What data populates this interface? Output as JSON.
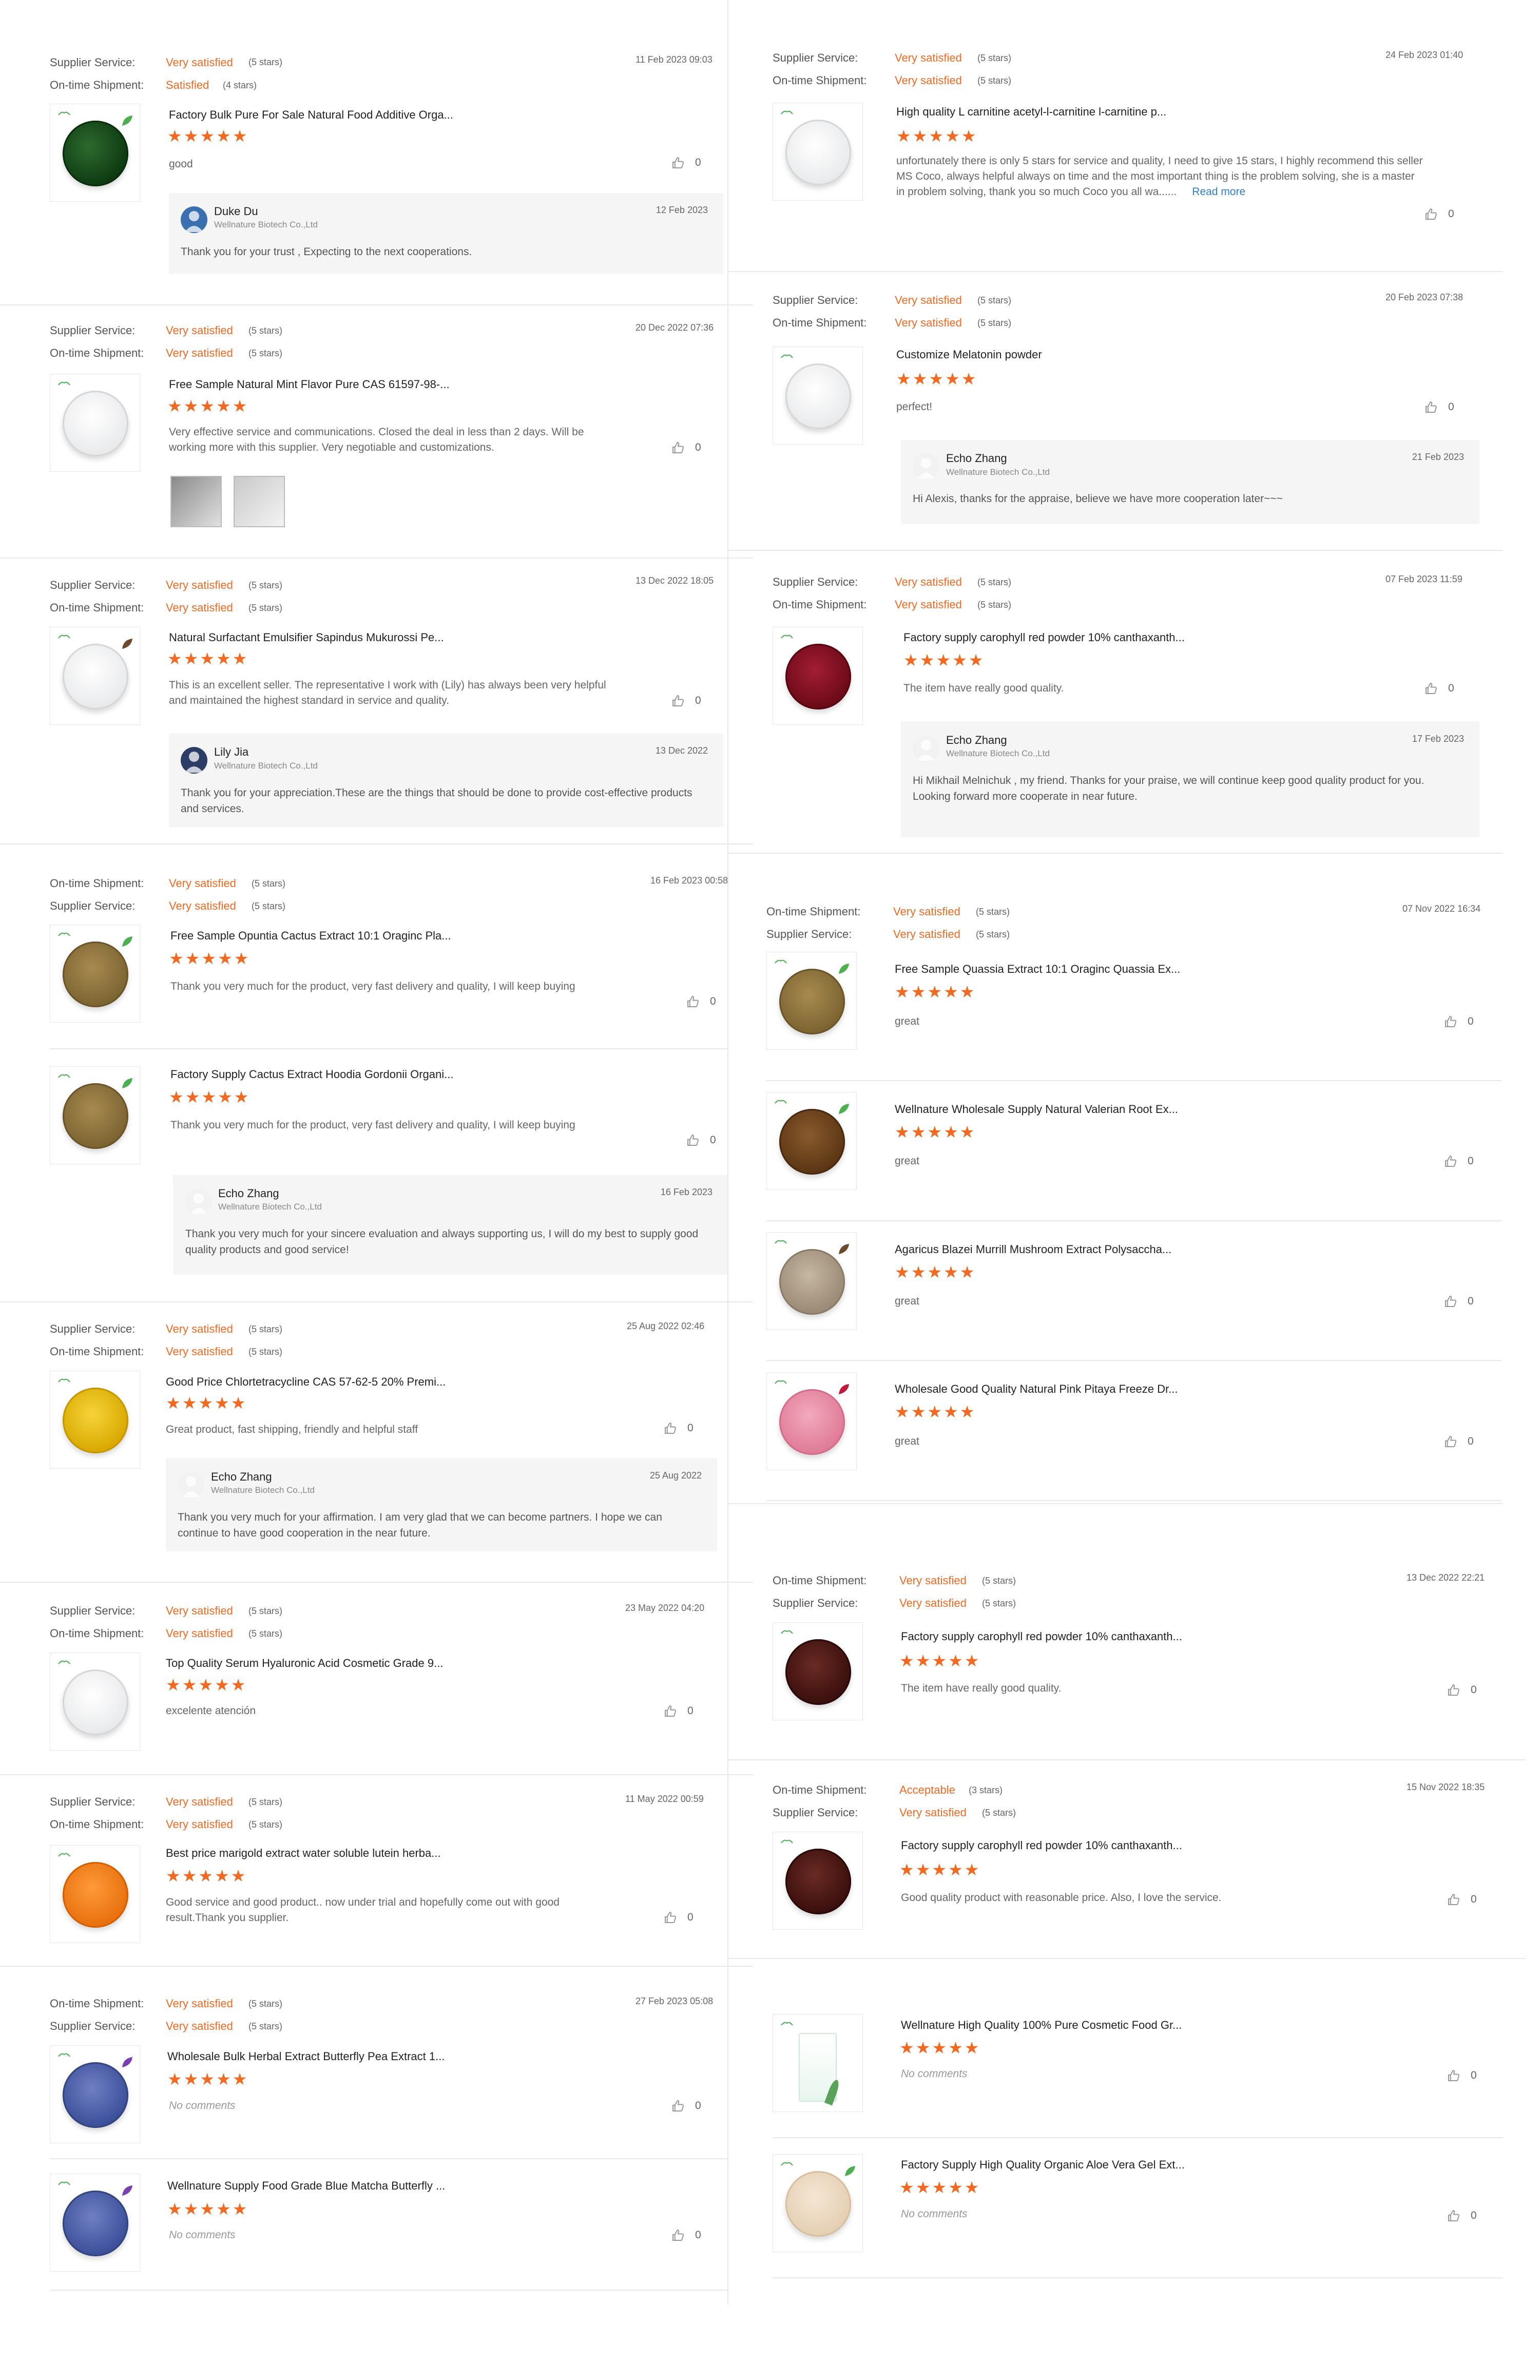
{
  "labels": {
    "supplier_service": "Supplier Service:",
    "ontime_shipment": "On-time Shipment:"
  },
  "accent_color": "#f26a21",
  "stars_glyph": "★★★★★",
  "left": [
    {
      "rows": [
        [
          "Supplier Service:",
          "Very satisfied",
          "(5 stars)"
        ],
        [
          "On-time Shipment:",
          "Satisfied",
          "(4 stars)"
        ]
      ],
      "date": "11 Feb 2023 09:03",
      "product": "Factory Bulk Pure For Sale Natural Food Additive Orga...",
      "rating": 5,
      "comment": "good",
      "likes": "0",
      "reply": {
        "name": "Duke Du",
        "company": "Wellnature Biotech Co.,Ltd",
        "date": "12 Feb 2023",
        "text": "Thank you for your trust , Expecting to the next cooperations."
      }
    },
    {
      "rows": [
        [
          "Supplier Service:",
          "Very satisfied",
          "(5 stars)"
        ],
        [
          "On-time Shipment:",
          "Very satisfied",
          "(5 stars)"
        ]
      ],
      "date": "20 Dec 2022 07:36",
      "product": "Free Sample Natural Mint Flavor Pure CAS 61597-98-...",
      "rating": 5,
      "comment": "Very effective service and communications. Closed the deal in less than 2 days. Will be working more with this supplier. Very negotiable and customizations.",
      "likes": "0"
    },
    {
      "rows": [
        [
          "Supplier Service:",
          "Very satisfied",
          "(5 stars)"
        ],
        [
          "On-time Shipment:",
          "Very satisfied",
          "(5 stars)"
        ]
      ],
      "date": "13 Dec 2022 18:05",
      "product": "Natural Surfactant Emulsifier Sapindus Mukurossi Pe...",
      "rating": 5,
      "comment": "This is an excellent seller. The representative I work with (Lily) has always been very helpful and maintained the highest standard in service and quality.",
      "likes": "0",
      "reply": {
        "name": "Lily Jia",
        "company": "Wellnature Biotech Co.,Ltd",
        "date": "13 Dec 2022",
        "text": "Thank you for your appreciation.These are the things that should be done to provide cost-effective products and services."
      }
    },
    {
      "rows": [
        [
          "On-time Shipment:",
          "Very satisfied",
          "(5 stars)"
        ],
        [
          "Supplier Service:",
          "Very satisfied",
          "(5 stars)"
        ]
      ],
      "date": "16 Feb 2023 00:58",
      "product": "Free Sample Opuntia Cactus Extract 10:1 Oraginc Pla...",
      "rating": 5,
      "comment": "Thank you very much for the product, very fast delivery and quality, I will keep buying",
      "likes": "0",
      "product2": "Factory Supply Cactus Extract Hoodia Gordonii Organi...",
      "rating2": 5,
      "comment2": "Thank you very much for the product, very fast delivery and quality, I will keep buying",
      "likes2": "0",
      "reply": {
        "name": "Echo Zhang",
        "company": "Wellnature Biotech Co.,Ltd",
        "date": "16 Feb 2023",
        "text": "Thank you very much for your sincere evaluation and always supporting us, I will do my best to supply good quality products and good service!"
      }
    },
    {
      "rows": [
        [
          "Supplier Service:",
          "Very satisfied",
          "(5 stars)"
        ],
        [
          "On-time Shipment:",
          "Very satisfied",
          "(5 stars)"
        ]
      ],
      "date": "25 Aug 2022 02:46",
      "product": "Good Price Chlortetracycline CAS 57-62-5 20% Premi...",
      "rating": 5,
      "comment": "Great product, fast shipping, friendly and helpful staff",
      "likes": "0",
      "reply": {
        "name": "Echo Zhang",
        "company": "Wellnature Biotech Co.,Ltd",
        "date": "25 Aug 2022",
        "text": "Thank you very much for your affirmation. I am very glad that we can become partners. I hope we can continue to have good cooperation in the near future."
      }
    },
    {
      "rows": [
        [
          "Supplier Service:",
          "Very satisfied",
          "(5 stars)"
        ],
        [
          "On-time Shipment:",
          "Very satisfied",
          "(5 stars)"
        ]
      ],
      "date": "23 May 2022 04:20",
      "product": "Top Quality Serum Hyaluronic Acid Cosmetic Grade 9...",
      "rating": 5,
      "comment": "excelente atención",
      "likes": "0"
    },
    {
      "rows": [
        [
          "Supplier Service:",
          "Very satisfied",
          "(5 stars)"
        ],
        [
          "On-time Shipment:",
          "Very satisfied",
          "(5 stars)"
        ]
      ],
      "date": "11 May 2022 00:59",
      "product": "Best price marigold extract water soluble lutein herba...",
      "rating": 5,
      "comment": "Good service and good product.. now under trial and hopefully come out with good result.Thank you supplier.",
      "likes": "0"
    },
    {
      "rows": [
        [
          "On-time Shipment:",
          "Very satisfied",
          "(5 stars)"
        ],
        [
          "Supplier Service:",
          "Very satisfied",
          "(5 stars)"
        ]
      ],
      "date": "27 Feb 2023 05:08",
      "product": "Wholesale Bulk Herbal Extract Butterfly Pea Extract 1...",
      "rating": 5,
      "comment": "No comments",
      "likes": "0",
      "product2": "Wellnature Supply Food Grade Blue Matcha Butterfly ...",
      "rating2": 5,
      "comment2": "No comments",
      "likes2": "0"
    }
  ],
  "right": [
    {
      "rows": [
        [
          "Supplier Service:",
          "Very satisfied",
          "(5 stars)"
        ],
        [
          "On-time Shipment:",
          "Very satisfied",
          "(5 stars)"
        ]
      ],
      "date": "24 Feb 2023 01:40",
      "product": "High quality L carnitine acetyl-l-carnitine l-carnitine p...",
      "rating": 5,
      "comment": "unfortunately there is only 5 stars for service and quality,  I need to give 15 stars, I highly recommend this seller MS Coco,  always helpful always on time and the most important thing is the problem solving,  she is a master in problem solving,  thank you so much Coco you all wa......",
      "read_more": "Read more",
      "likes": "0"
    },
    {
      "rows": [
        [
          "Supplier Service:",
          "Very satisfied",
          "(5 stars)"
        ],
        [
          "On-time Shipment:",
          "Very satisfied",
          "(5 stars)"
        ]
      ],
      "date": "20 Feb 2023 07:38",
      "product": "Customize Melatonin powder",
      "rating": 5,
      "comment": "perfect!",
      "likes": "0",
      "reply": {
        "name": "Echo Zhang",
        "company": "Wellnature Biotech Co.,Ltd",
        "date": "21 Feb 2023",
        "text": "Hi Alexis, thanks for the appraise, believe we have more cooperation later~~~"
      }
    },
    {
      "rows": [
        [
          "Supplier Service:",
          "Very satisfied",
          "(5 stars)"
        ],
        [
          "On-time Shipment:",
          "Very satisfied",
          "(5 stars)"
        ]
      ],
      "date": "07 Feb 2023 11:59",
      "product": "Factory supply carophyll red powder 10% canthaxanth...",
      "rating": 5,
      "comment": "The item have really good quality.",
      "likes": "0",
      "reply": {
        "name": "Echo Zhang",
        "company": "Wellnature Biotech Co.,Ltd",
        "date": "17 Feb 2023",
        "text": "Hi Mikhail Melnichuk , my friend. Thanks for your praise, we will continue keep good quality product for you. Looking forward more cooperate in near future."
      }
    },
    {
      "rows": [
        [
          "On-time Shipment:",
          "Very satisfied",
          "(5 stars)"
        ],
        [
          "Supplier Service:",
          "Very satisfied",
          "(5 stars)"
        ]
      ],
      "date": "07 Nov 2022 16:34",
      "items": [
        {
          "product": "Free Sample Quassia Extract 10:1 Oraginc Quassia Ex...",
          "rating": 5,
          "comment": "great",
          "likes": "0"
        },
        {
          "product": "Wellnature Wholesale Supply Natural Valerian Root Ex...",
          "rating": 5,
          "comment": "great",
          "likes": "0"
        },
        {
          "product": "Agaricus Blazei Murrill Mushroom Extract Polysaccha...",
          "rating": 5,
          "comment": "great",
          "likes": "0"
        },
        {
          "product": "Wholesale Good Quality Natural Pink Pitaya Freeze Dr...",
          "rating": 5,
          "comment": "great",
          "likes": "0"
        }
      ]
    },
    {
      "rows": [
        [
          "On-time Shipment:",
          "Very satisfied",
          "(5 stars)"
        ],
        [
          "Supplier Service:",
          "Very satisfied",
          "(5 stars)"
        ]
      ],
      "date": "13 Dec 2022 22:21",
      "product": "Factory supply carophyll red powder 10% canthaxanth...",
      "rating": 5,
      "comment": "The item have really good quality.",
      "likes": "0"
    },
    {
      "rows": [
        [
          "On-time Shipment:",
          "Acceptable",
          "(3 stars)"
        ],
        [
          "Supplier Service:",
          "Very satisfied",
          "(5 stars)"
        ]
      ],
      "date": "15 Nov 2022 18:35",
      "product": "Factory supply carophyll red powder 10% canthaxanth...",
      "rating": 5,
      "comment": "Good quality product with reasonable price. Also, I love the service.",
      "likes": "0"
    },
    {
      "items": [
        {
          "product": "Wellnature High Quality 100% Pure Cosmetic Food Gr...",
          "rating": 5,
          "comment": "No comments",
          "likes": "0"
        },
        {
          "product": "Factory Supply High Quality Organic Aloe Vera Gel Ext...",
          "rating": 5,
          "comment": "No comments",
          "likes": "0"
        }
      ]
    }
  ]
}
